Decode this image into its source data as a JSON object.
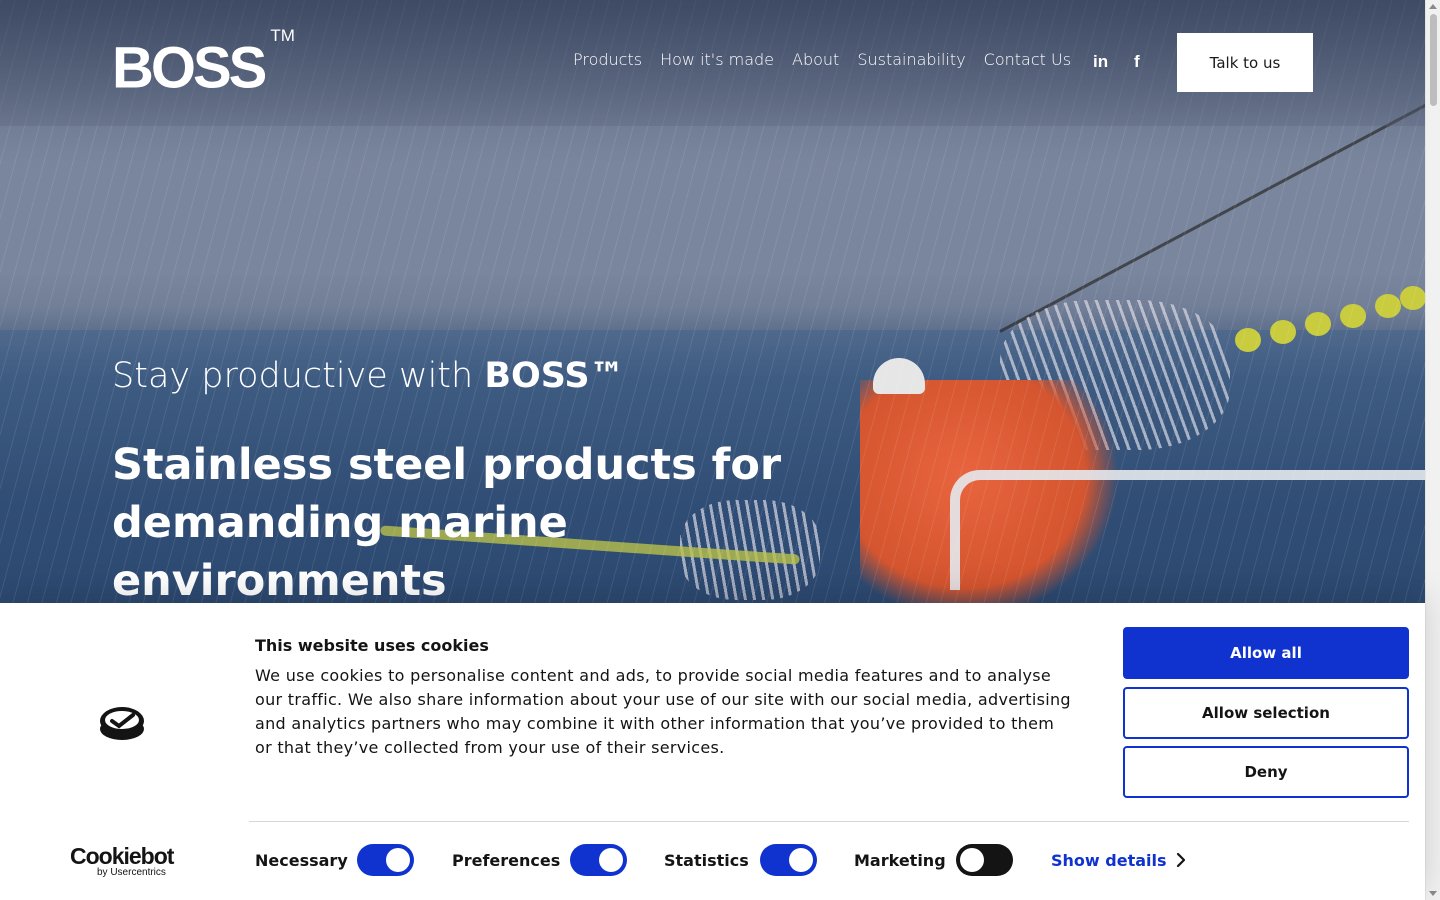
{
  "header": {
    "logo_text": "BOSS",
    "logo_tm": "TM",
    "nav": [
      "Products",
      "How it's made",
      "About",
      "Sustainability",
      "Contact Us"
    ],
    "social_icons": [
      "linkedin-icon",
      "facebook-icon"
    ],
    "social_glyphs": {
      "linkedin": "in",
      "facebook": "f"
    },
    "cta_label": "Talk to us"
  },
  "hero": {
    "tagline_prefix": "Stay productive with ",
    "tagline_brand": "BOSS™",
    "headline": "Stainless steel products for demanding marine environments"
  },
  "cookie_banner": {
    "title": "This website uses cookies",
    "text": "We use cookies to personalise content and ads, to provide social media features and to analyse our traffic. We also share information about your use of our site with our social media, advertising and analytics partners who may combine it with other information that you’ve provided to them or that they’ve collected from your use of their services.",
    "brand": "Cookiebot",
    "brand_sub": "by Usercentrics",
    "buttons": {
      "allow_all": "Allow all",
      "allow_selection": "Allow selection",
      "deny": "Deny"
    },
    "categories": [
      {
        "label": "Necessary",
        "enabled": true
      },
      {
        "label": "Preferences",
        "enabled": true
      },
      {
        "label": "Statistics",
        "enabled": true
      },
      {
        "label": "Marketing",
        "enabled": false
      }
    ],
    "show_details": "Show details",
    "accent_color": "#1032cf"
  }
}
